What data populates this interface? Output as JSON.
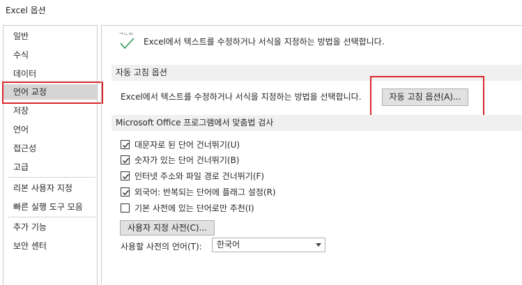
{
  "window": {
    "title": "Excel 옵션"
  },
  "sidebar": {
    "items": [
      {
        "label": "일반"
      },
      {
        "label": "수식"
      },
      {
        "label": "데이터"
      },
      {
        "label": "언어 교정"
      },
      {
        "label": "저장"
      },
      {
        "label": "언어"
      },
      {
        "label": "접근성"
      },
      {
        "label": "고급"
      },
      {
        "label": "리본 사용자 지정"
      },
      {
        "label": "빠른 실행 도구 모음"
      },
      {
        "label": "추가 기능"
      },
      {
        "label": "보안 센터"
      }
    ],
    "active_index": 3
  },
  "main": {
    "header_text": "Excel에서 텍스트를 수정하거나 서식을 지정하는 방법을 선택합니다.",
    "autocorrect": {
      "section_title": "자동 고침 옵션",
      "description": "Excel에서 텍스트를 수정하거나 서식을 지정하는 방법을 선택합니다.",
      "button_label": "자동 고침 옵션(A)..."
    },
    "spelling": {
      "section_title": "Microsoft Office 프로그램에서 맞춤법 검사",
      "options": [
        {
          "label": "대문자로 된 단어 건너뛰기(U)",
          "checked": true
        },
        {
          "label": "숫자가 있는 단어 건너뛰기(B)",
          "checked": true
        },
        {
          "label": "인터넷 주소와 파일 경로 건너뛰기(F)",
          "checked": true
        },
        {
          "label": "외국어: 반복되는 단어에 플래그 설정(R)",
          "checked": true
        },
        {
          "label": "기본 사전에 있는 단어로만 추천(I)",
          "checked": false
        }
      ],
      "custom_dict_button": "사용자 지정 사전(C)...",
      "dictionary_language_label": "사용할 사전의 언어(T):",
      "dictionary_language_value": "한국어"
    }
  },
  "colors": {
    "highlight": "#d9252a",
    "accent_check": "#2e9b52"
  }
}
